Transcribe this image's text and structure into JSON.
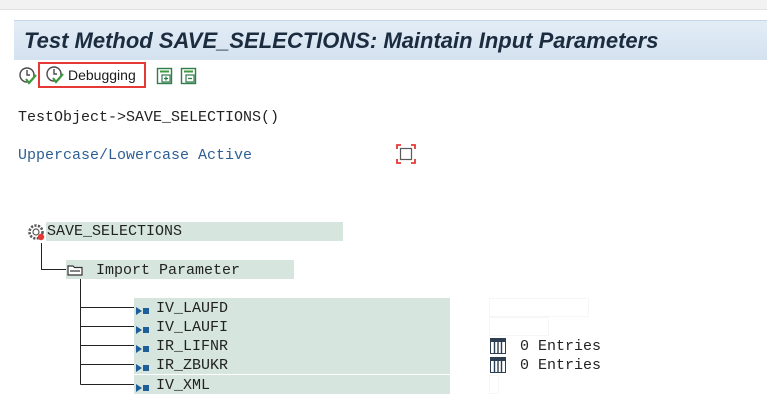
{
  "window": {
    "title": "Test Method SAVE_SELECTIONS: Maintain Input Parameters"
  },
  "toolbar": {
    "execute_icon": "execute-clock-icon",
    "debugging_label": "Debugging",
    "expand_icon": "expand-all-icon",
    "collapse_icon": "collapse-all-icon"
  },
  "method_call": "TestObject->SAVE_SELECTIONS()",
  "case_option": {
    "label": "Uppercase/Lowercase Active",
    "checked": false
  },
  "tree": {
    "root_label": "SAVE_SELECTIONS",
    "import_label": "Import Parameter",
    "parameters": [
      {
        "name": "IV_LAUFD",
        "value": ""
      },
      {
        "name": "IV_LAUFI",
        "value": ""
      },
      {
        "name": "IR_LIFNR",
        "value": "0 Entries"
      },
      {
        "name": "IR_ZBUKR",
        "value": "0 Entries"
      },
      {
        "name": "IV_XML",
        "value": ""
      }
    ]
  },
  "colors": {
    "title_bg": "#dbe7f3",
    "node_bg": "#d6e6df",
    "highlight": "#e53935",
    "link_text": "#2d5f94"
  }
}
